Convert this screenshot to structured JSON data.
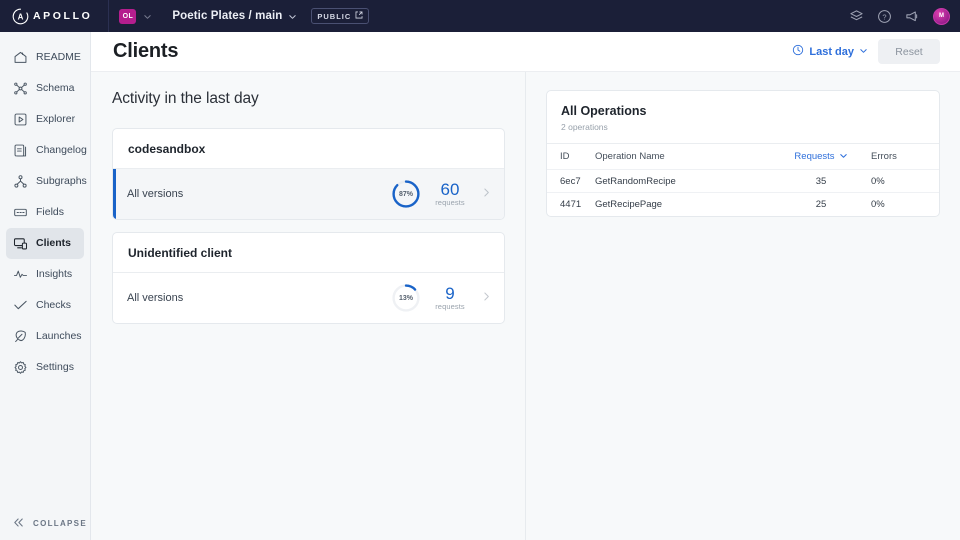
{
  "topbar": {
    "logo_text": "APOLLO",
    "org_badge": "OL",
    "graph_name": "Poetic Plates / main",
    "visibility": "PUBLIC",
    "icons": [
      "stack-icon",
      "help-icon",
      "megaphone-icon"
    ],
    "avatar_initials": "M"
  },
  "sidebar": {
    "items": [
      {
        "label": "README",
        "icon": "readme-icon",
        "active": false
      },
      {
        "label": "Schema",
        "icon": "schema-icon",
        "active": false
      },
      {
        "label": "Explorer",
        "icon": "explorer-icon",
        "active": false
      },
      {
        "label": "Changelog",
        "icon": "changelog-icon",
        "active": false
      },
      {
        "label": "Subgraphs",
        "icon": "subgraphs-icon",
        "active": false
      },
      {
        "label": "Fields",
        "icon": "fields-icon",
        "active": false
      },
      {
        "label": "Clients",
        "icon": "clients-icon",
        "active": true
      },
      {
        "label": "Insights",
        "icon": "insights-icon",
        "active": false
      },
      {
        "label": "Checks",
        "icon": "checks-icon",
        "active": false
      },
      {
        "label": "Launches",
        "icon": "launches-icon",
        "active": false
      },
      {
        "label": "Settings",
        "icon": "settings-icon",
        "active": false
      }
    ],
    "collapse_label": "COLLAPSE"
  },
  "page": {
    "title": "Clients",
    "date_range": "Last day",
    "reset_label": "Reset"
  },
  "activity": {
    "heading": "Activity in the last day",
    "cards": [
      {
        "name": "codesandbox",
        "version_label": "All versions",
        "percent": 87,
        "percent_label": "87%",
        "requests": "60",
        "requests_label": "requests",
        "selected": true
      },
      {
        "name": "Unidentified client",
        "version_label": "All versions",
        "percent": 13,
        "percent_label": "13%",
        "requests": "9",
        "requests_label": "requests",
        "selected": false
      }
    ]
  },
  "operations": {
    "title": "All Operations",
    "subtitle": "2 operations",
    "columns": [
      "ID",
      "Operation Name",
      "Requests",
      "Errors"
    ],
    "sort_column": "Requests",
    "rows": [
      {
        "id": "6ec7",
        "name": "GetRandomRecipe",
        "requests": "35",
        "errors": "0%"
      },
      {
        "id": "4471",
        "name": "GetRecipePage",
        "requests": "25",
        "errors": "0%"
      }
    ]
  },
  "colors": {
    "topbar_bg": "#1b1f38",
    "accent_blue": "#1963c8",
    "link_blue": "#2e6fdb",
    "badge_magenta": "#b51e8e",
    "sidebar_bg": "#f4f6f8",
    "content_bg": "#f7f9fa"
  }
}
